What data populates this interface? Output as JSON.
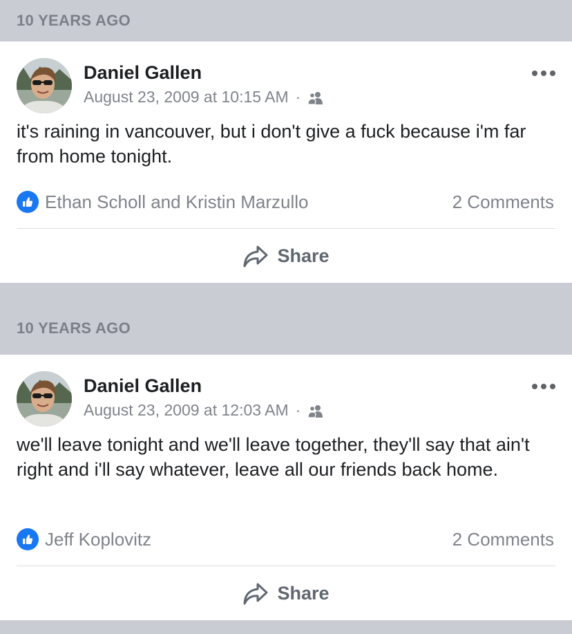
{
  "memories": [
    {
      "header": "10 YEARS AGO",
      "post": {
        "author": "Daniel Gallen",
        "timestamp": "August 23, 2009 at 10:15 AM",
        "separator": "·",
        "audience_icon": "friends-icon",
        "text": "it's raining in vancouver, but i don't give a fuck because i'm far from home tonight.",
        "likers": "Ethan Scholl and Kristin Marzullo",
        "comments": "2 Comments",
        "share_label": "Share"
      }
    },
    {
      "header": "10 YEARS AGO",
      "post": {
        "author": "Daniel Gallen",
        "timestamp": "August 23, 2009 at 12:03 AM",
        "separator": "·",
        "audience_icon": "friends-icon",
        "text": "we'll leave tonight and we'll leave together, they'll say that ain't right and i'll say whatever, leave all our friends back home.",
        "likers": "Jeff Koplovitz",
        "comments": "2 Comments",
        "share_label": "Share"
      }
    }
  ],
  "colors": {
    "background": "#c9ccd3",
    "card": "#ffffff",
    "like_blue": "#1877f2",
    "secondary_text": "#7f838a"
  }
}
